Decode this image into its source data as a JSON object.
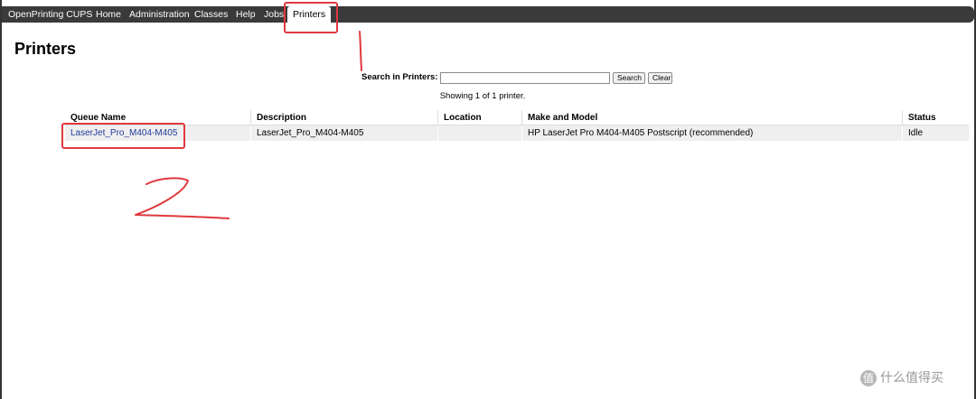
{
  "nav": {
    "brand": "OpenPrinting CUPS",
    "items": [
      "Home",
      "Administration",
      "Classes",
      "Help",
      "Jobs",
      "Printers"
    ],
    "active": "Printers"
  },
  "page": {
    "title": "Printers",
    "search_label": "Search in Printers:",
    "search_value": "",
    "search_button": "Search",
    "clear_button": "Clear",
    "showing": "Showing 1 of 1 printer."
  },
  "table": {
    "headers": [
      "Queue Name",
      "Description",
      "Location",
      "Make and Model",
      "Status"
    ],
    "rows": [
      {
        "queue_name": "LaserJet_Pro_M404-M405",
        "description": "LaserJet_Pro_M404-M405",
        "location": "",
        "make_model": "HP LaserJet Pro M404-M405 Postscript (recommended)",
        "status": "Idle"
      }
    ]
  },
  "annotations": {
    "color": "#e0393e",
    "step1": "1",
    "step2": "2"
  },
  "watermark": {
    "logo": "值",
    "text": "什么值得买"
  }
}
